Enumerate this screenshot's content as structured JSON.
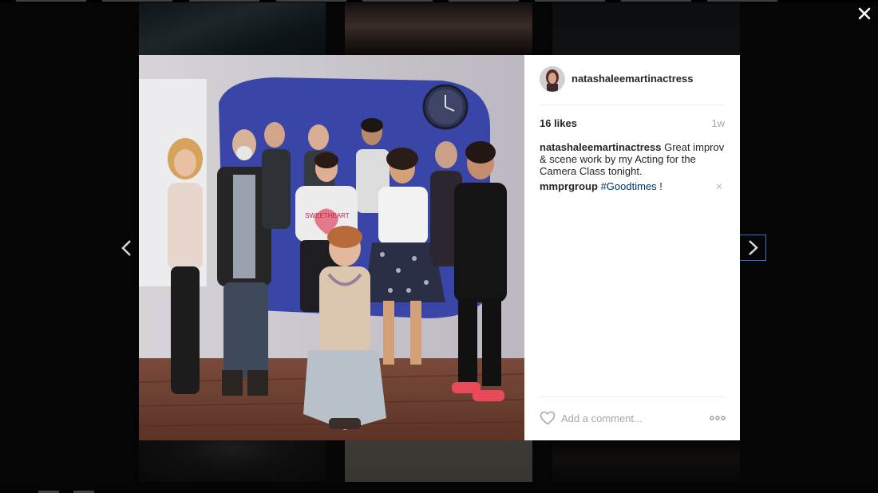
{
  "post": {
    "username": "natashaleemartinactress",
    "likes": "16 likes",
    "time_ago": "1w",
    "caption_user": "natashaleemartinactress",
    "caption_text": "Great improv & scene work by my Acting for the Camera Class tonight."
  },
  "comments": [
    {
      "user": "mmprgroup",
      "hashtag": "#Goodtimes",
      "text": " !"
    }
  ],
  "comment_box": {
    "placeholder": "Add a comment..."
  },
  "photo": {
    "shirt_text": "SWEETHEART"
  },
  "icons": {
    "close": "close-icon",
    "prev": "chevron-left-icon",
    "next": "chevron-right-icon",
    "like": "heart-icon",
    "more": "more-options-icon",
    "remove": "remove-comment-icon"
  },
  "colors": {
    "hashtag": "#003569",
    "muted": "#a5a7aa",
    "text": "#262626",
    "focus": "#3b6fd6"
  }
}
